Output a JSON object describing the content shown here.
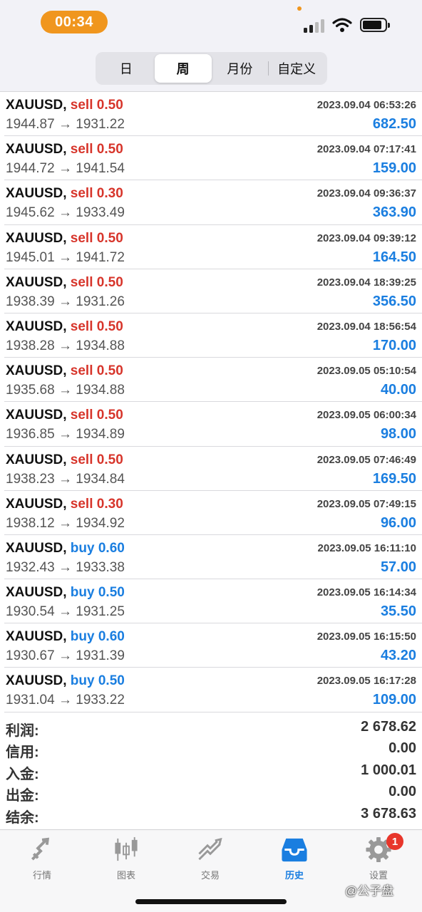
{
  "status": {
    "time": "00:34"
  },
  "segments": [
    {
      "label": "日",
      "active": false
    },
    {
      "label": "周",
      "active": true
    },
    {
      "label": "月份",
      "active": false
    },
    {
      "label": "自定义",
      "active": false
    }
  ],
  "trades": [
    {
      "symbol": "XAUUSD,",
      "side": "sell",
      "volume": "0.50",
      "time": "2023.09.04 06:53:26",
      "open": "1944.87",
      "close": "1931.22",
      "profit": "682.50"
    },
    {
      "symbol": "XAUUSD,",
      "side": "sell",
      "volume": "0.50",
      "time": "2023.09.04 07:17:41",
      "open": "1944.72",
      "close": "1941.54",
      "profit": "159.00"
    },
    {
      "symbol": "XAUUSD,",
      "side": "sell",
      "volume": "0.30",
      "time": "2023.09.04 09:36:37",
      "open": "1945.62",
      "close": "1933.49",
      "profit": "363.90"
    },
    {
      "symbol": "XAUUSD,",
      "side": "sell",
      "volume": "0.50",
      "time": "2023.09.04 09:39:12",
      "open": "1945.01",
      "close": "1941.72",
      "profit": "164.50"
    },
    {
      "symbol": "XAUUSD,",
      "side": "sell",
      "volume": "0.50",
      "time": "2023.09.04 18:39:25",
      "open": "1938.39",
      "close": "1931.26",
      "profit": "356.50"
    },
    {
      "symbol": "XAUUSD,",
      "side": "sell",
      "volume": "0.50",
      "time": "2023.09.04 18:56:54",
      "open": "1938.28",
      "close": "1934.88",
      "profit": "170.00"
    },
    {
      "symbol": "XAUUSD,",
      "side": "sell",
      "volume": "0.50",
      "time": "2023.09.05 05:10:54",
      "open": "1935.68",
      "close": "1934.88",
      "profit": "40.00"
    },
    {
      "symbol": "XAUUSD,",
      "side": "sell",
      "volume": "0.50",
      "time": "2023.09.05 06:00:34",
      "open": "1936.85",
      "close": "1934.89",
      "profit": "98.00"
    },
    {
      "symbol": "XAUUSD,",
      "side": "sell",
      "volume": "0.50",
      "time": "2023.09.05 07:46:49",
      "open": "1938.23",
      "close": "1934.84",
      "profit": "169.50"
    },
    {
      "symbol": "XAUUSD,",
      "side": "sell",
      "volume": "0.30",
      "time": "2023.09.05 07:49:15",
      "open": "1938.12",
      "close": "1934.92",
      "profit": "96.00"
    },
    {
      "symbol": "XAUUSD,",
      "side": "buy",
      "volume": "0.60",
      "time": "2023.09.05 16:11:10",
      "open": "1932.43",
      "close": "1933.38",
      "profit": "57.00"
    },
    {
      "symbol": "XAUUSD,",
      "side": "buy",
      "volume": "0.50",
      "time": "2023.09.05 16:14:34",
      "open": "1930.54",
      "close": "1931.25",
      "profit": "35.50"
    },
    {
      "symbol": "XAUUSD,",
      "side": "buy",
      "volume": "0.60",
      "time": "2023.09.05 16:15:50",
      "open": "1930.67",
      "close": "1931.39",
      "profit": "43.20"
    },
    {
      "symbol": "XAUUSD,",
      "side": "buy",
      "volume": "0.50",
      "time": "2023.09.05 16:17:28",
      "open": "1931.04",
      "close": "1933.22",
      "profit": "109.00"
    }
  ],
  "arrow": "→",
  "summary": [
    {
      "label": "利润:",
      "value": "2 678.62"
    },
    {
      "label": "信用:",
      "value": "0.00"
    },
    {
      "label": "入金:",
      "value": "1 000.01"
    },
    {
      "label": "出金:",
      "value": "0.00"
    },
    {
      "label": "结余:",
      "value": "3 678.63"
    }
  ],
  "tabs": [
    {
      "label": "行情",
      "icon": "quotes-icon",
      "active": false
    },
    {
      "label": "图表",
      "icon": "candlestick-chart-icon",
      "active": false
    },
    {
      "label": "交易",
      "icon": "trade-icon",
      "active": false
    },
    {
      "label": "历史",
      "icon": "history-inbox-icon",
      "active": true
    },
    {
      "label": "设置",
      "icon": "gear-icon",
      "active": false,
      "badge": "1"
    }
  ],
  "colors": {
    "sell": "#d7352b",
    "buy": "#1a7ee0",
    "profit": "#1a7ee0",
    "accent": "#f0961e"
  },
  "watermark": "@公子盘"
}
